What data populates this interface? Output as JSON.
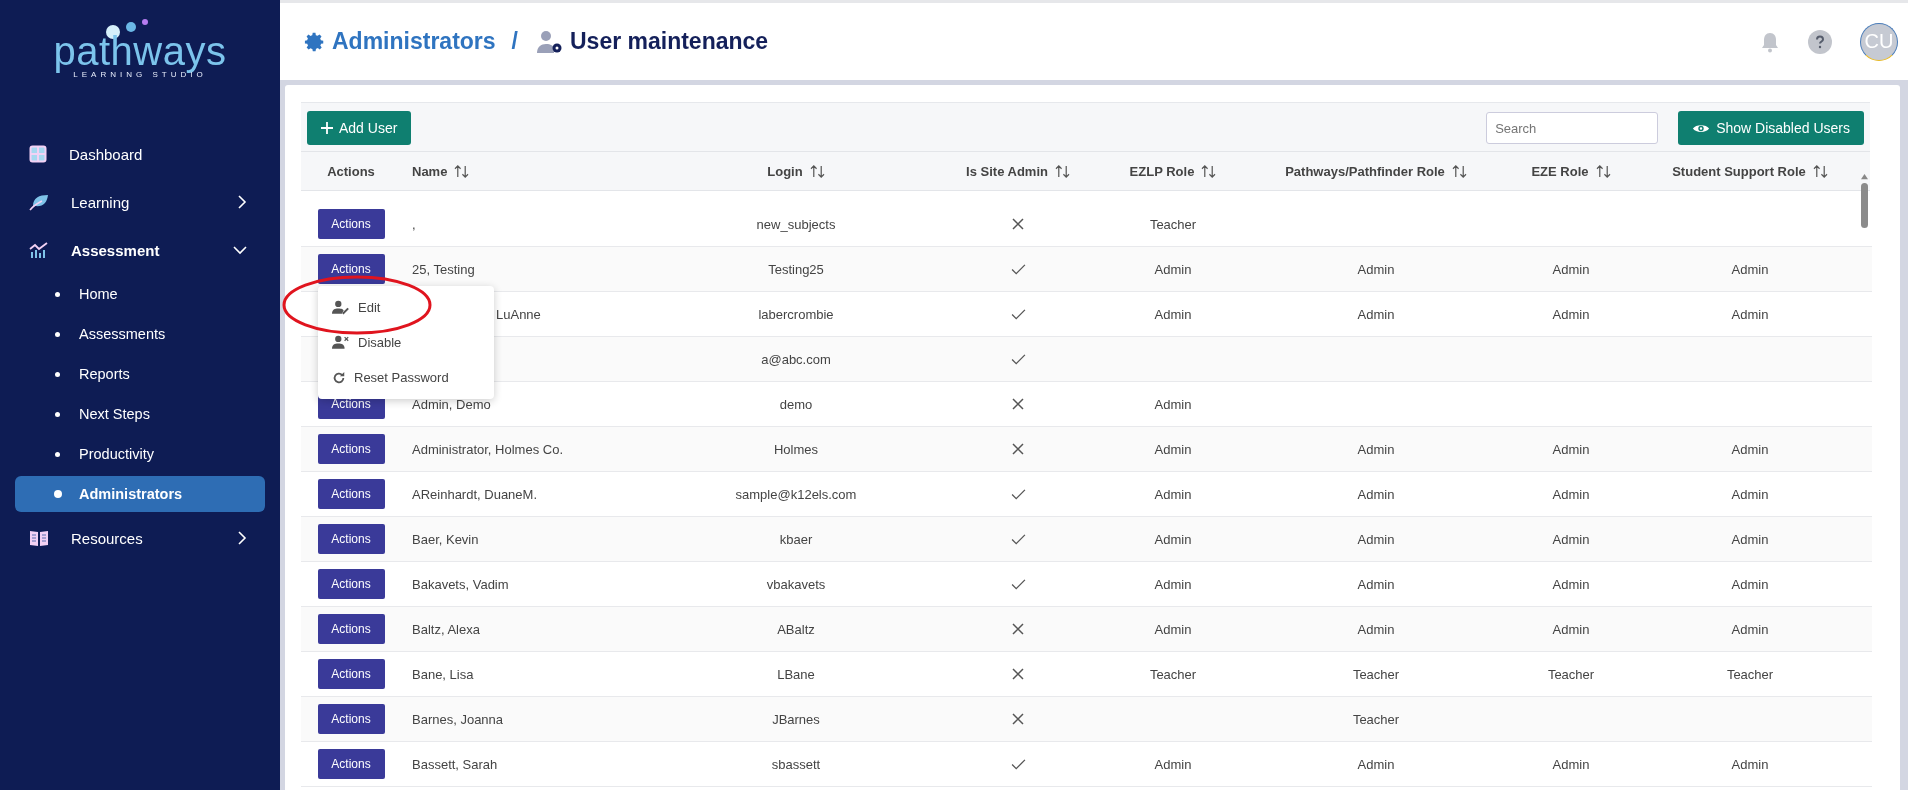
{
  "logo": {
    "name": "pathways",
    "tagline": "LEARNING STUDIO"
  },
  "sidebar": {
    "items": [
      {
        "label": "Dashboard"
      },
      {
        "label": "Learning",
        "expanded": false
      },
      {
        "label": "Assessment",
        "expanded": true,
        "children": [
          {
            "label": "Home",
            "selected": false
          },
          {
            "label": "Assessments",
            "selected": false
          },
          {
            "label": "Reports",
            "selected": false
          },
          {
            "label": "Next Steps",
            "selected": false
          },
          {
            "label": "Productivity",
            "selected": false
          },
          {
            "label": "Administrators",
            "selected": true
          }
        ]
      },
      {
        "label": "Resources",
        "expanded": false
      }
    ]
  },
  "breadcrumb": {
    "items": [
      "Administrators",
      "User maintenance"
    ],
    "separator": "/"
  },
  "header": {
    "avatar": "CU"
  },
  "toolbar": {
    "add_button": "Add User",
    "search": {
      "placeholder": "Search"
    },
    "show_disabled_button": "Show Disabled Users"
  },
  "table": {
    "columns": [
      "Actions",
      "Name",
      "Login",
      "Is Site Admin",
      "EZLP Role",
      "Pathways/Pathfinder Role",
      "EZE Role",
      "Student Support Role"
    ],
    "rows": [
      {
        "action": "Actions",
        "name": ",",
        "login": "new_subjects",
        "is_site_admin": false,
        "ezlp": "Teacher"
      },
      {
        "action": "Actions",
        "name": "25, Testing",
        "login": "Testing25",
        "is_site_admin": true,
        "ezlp": "Admin",
        "pathways": "Admin",
        "eze": "Admin",
        "support": "Admin"
      },
      {
        "name": "LuAnne",
        "login": "labercrombie",
        "is_site_admin": true,
        "ezlp": "Admin",
        "pathways": "Admin",
        "eze": "Admin",
        "support": "Admin"
      },
      {
        "login": "a@abc.com",
        "is_site_admin": true
      },
      {
        "action": "Actions",
        "name": "Admin, Demo",
        "login": "demo",
        "is_site_admin": false,
        "ezlp": "Admin"
      },
      {
        "action": "Actions",
        "name": "Administrator, Holmes Co.",
        "login": "Holmes",
        "is_site_admin": false,
        "ezlp": "Admin",
        "pathways": "Admin",
        "eze": "Admin",
        "support": "Admin"
      },
      {
        "action": "Actions",
        "name": "AReinhardt, DuaneM.",
        "login": "sample@k12els.com",
        "is_site_admin": true,
        "ezlp": "Admin",
        "pathways": "Admin",
        "eze": "Admin",
        "support": "Admin"
      },
      {
        "action": "Actions",
        "name": "Baer, Kevin",
        "login": "kbaer",
        "is_site_admin": true,
        "ezlp": "Admin",
        "pathways": "Admin",
        "eze": "Admin",
        "support": "Admin"
      },
      {
        "action": "Actions",
        "name": "Bakavets, Vadim",
        "login": "vbakavets",
        "is_site_admin": true,
        "ezlp": "Admin",
        "pathways": "Admin",
        "eze": "Admin",
        "support": "Admin"
      },
      {
        "action": "Actions",
        "name": "Baltz, Alexa",
        "login": "ABaltz",
        "is_site_admin": false,
        "ezlp": "Admin",
        "pathways": "Admin",
        "eze": "Admin",
        "support": "Admin"
      },
      {
        "action": "Actions",
        "name": "Bane, Lisa",
        "login": "LBane",
        "is_site_admin": false,
        "ezlp": "Teacher",
        "pathways": "Teacher",
        "eze": "Teacher",
        "support": "Teacher"
      },
      {
        "action": "Actions",
        "name": "Barnes, Joanna",
        "login": "JBarnes",
        "is_site_admin": false,
        "pathways": "Teacher"
      },
      {
        "action": "Actions",
        "name": "Bassett, Sarah",
        "login": "sbassett",
        "is_site_admin": true,
        "ezlp": "Admin",
        "pathways": "Admin",
        "eze": "Admin",
        "support": "Admin"
      }
    ]
  },
  "row_menu": {
    "items": [
      "Edit",
      "Disable",
      "Reset Password"
    ]
  },
  "annotation": {
    "kind": "ellipse"
  }
}
